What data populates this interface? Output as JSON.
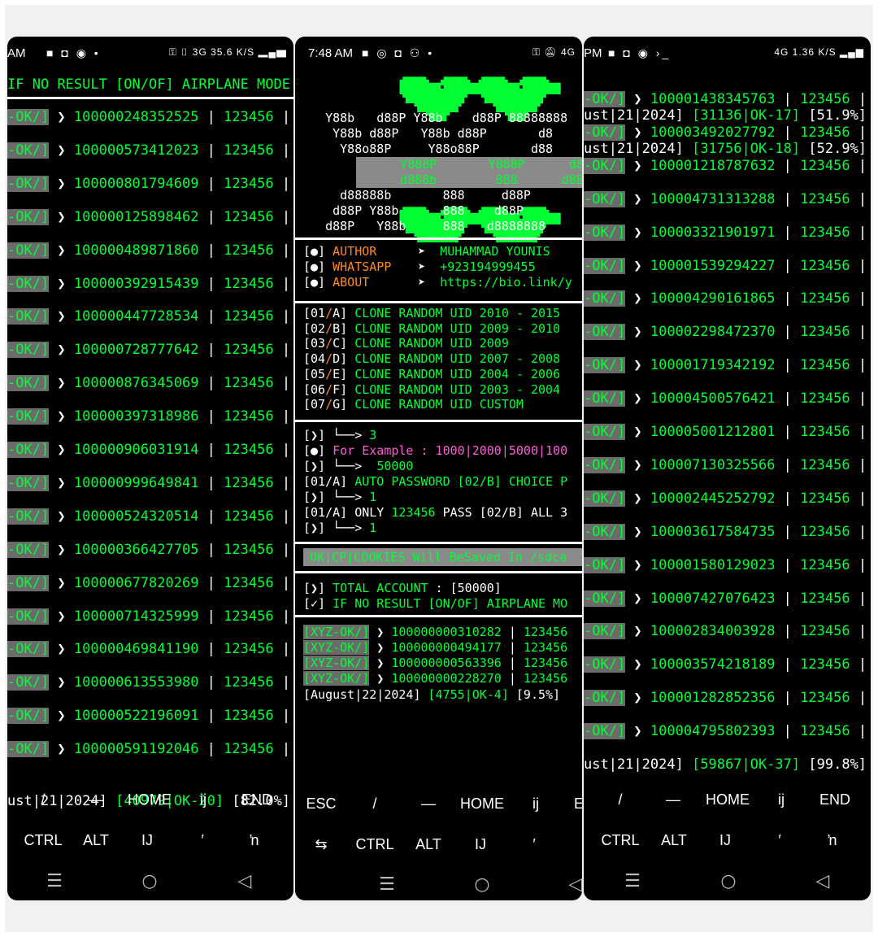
{
  "p1": {
    "status": {
      "time": "AM",
      "right": "3G 35.6 K/S"
    },
    "header": "IF NO RESULT [ON/OF] AIRPLANE MODE",
    "rows": [
      {
        "tag": "-OK/]",
        "uid": "100000248352525",
        "pw": "123456"
      },
      {
        "tag": "-OK/]",
        "uid": "100000573412023",
        "pw": "123456"
      },
      {
        "tag": "-OK/]",
        "uid": "100000801794609",
        "pw": "123456"
      },
      {
        "tag": "-OK/]",
        "uid": "100000125898462",
        "pw": "123456"
      },
      {
        "tag": "-OK/]",
        "uid": "100000489871860",
        "pw": "123456"
      },
      {
        "tag": "-OK/]",
        "uid": "100000392915439",
        "pw": "123456"
      },
      {
        "tag": "-OK/]",
        "uid": "100000447728534",
        "pw": "123456"
      },
      {
        "tag": "-OK/]",
        "uid": "100000728777642",
        "pw": "123456"
      },
      {
        "tag": "-OK/]",
        "uid": "100000876345069",
        "pw": "123456"
      },
      {
        "tag": "-OK/]",
        "uid": "100000397318986",
        "pw": "123456"
      },
      {
        "tag": "-OK/]",
        "uid": "100000906031914",
        "pw": "123456"
      },
      {
        "tag": "-OK/]",
        "uid": "100000999649841",
        "pw": "123456"
      },
      {
        "tag": "-OK/]",
        "uid": "100000524320514",
        "pw": "123456"
      },
      {
        "tag": "-OK/]",
        "uid": "100000366427705",
        "pw": "123456"
      },
      {
        "tag": "-OK/]",
        "uid": "100000677820269",
        "pw": "123456"
      },
      {
        "tag": "-OK/]",
        "uid": "100000714325999",
        "pw": "123456"
      },
      {
        "tag": "-OK/]",
        "uid": "100000469841190",
        "pw": "123456"
      },
      {
        "tag": "-OK/]",
        "uid": "100000613553980",
        "pw": "123456"
      },
      {
        "tag": "-OK/]",
        "uid": "100000522196091",
        "pw": "123456"
      },
      {
        "tag": "-OK/]",
        "uid": "100000591192046",
        "pw": "123456"
      }
    ],
    "footer": {
      "date": "ust|21|2024]",
      "count": "[40979|OK-20]",
      "pct": "[82.0%]"
    },
    "keys1": [
      "/",
      "—",
      "HOME",
      "ij",
      "END"
    ],
    "keys2": [
      "CTRL",
      "ALT",
      "IJ",
      "′",
      "ŉ"
    ]
  },
  "p2": {
    "status": {
      "time": "7:48 AM",
      "right": "4G"
    },
    "ascii": [
      "   Y88b   d88P Y88b    d88P 88888888",
      "    Y88b d88P   Y88b d88P       d8",
      "     Y88o88P     Y88o88P       d88",
      "      Y888P       Y888P      d88P",
      "      d888b        888      d88P",
      "     d88888b       888     d88P",
      "    d88P Y88b      888    d88P",
      "   d88P   Y88b     888   d8888888"
    ],
    "info": [
      {
        "bullet": "[●]",
        "label": "AUTHOR",
        "value": "MUHAMMAD YOUNIS"
      },
      {
        "bullet": "[●]",
        "label": "WHATSAPP",
        "value": "+923194999455"
      },
      {
        "bullet": "[●]",
        "label": "ABOUT",
        "value": "https://bio.link/y"
      }
    ],
    "menu": [
      {
        "num": "01",
        "key": "A",
        "text": "CLONE RANDOM UID 2010 - 2015"
      },
      {
        "num": "02",
        "key": "B",
        "text": "CLONE RANDOM UID 2009 - 2010"
      },
      {
        "num": "03",
        "key": "C",
        "text": "CLONE RANDOM UID 2009"
      },
      {
        "num": "04",
        "key": "D",
        "text": "CLONE RANDOM UID 2007 - 2008"
      },
      {
        "num": "05",
        "key": "E",
        "text": "CLONE RANDOM UID 2004 - 2006"
      },
      {
        "num": "06",
        "key": "F",
        "text": "CLONE RANDOM UID 2003 - 2004"
      },
      {
        "num": "07",
        "key": "G",
        "text": "CLONE RANDOM UID CUSTOM"
      }
    ],
    "input": {
      "ans1": "3",
      "example": "For Example : 1000|2000|5000|100",
      "ans2": "50000",
      "pwq": "AUTO PASSWORD [02/B] CHOICE P",
      "ans3": "1",
      "passq1": "ONLY",
      "passq2": "123456",
      "passq3": "PASS [02/B] ALL 3",
      "ans4": "1"
    },
    "banner": "OK|CP|COOKIES Will BeSaved In /sdca",
    "total": {
      "label": "TOTAL ACCOUNT",
      "value": "[50000]"
    },
    "airplane": "IF NO RESULT [ON/OF] AIRPLANE MO",
    "rows": [
      {
        "tag": "[XYZ-OK/]",
        "uid": "100000000310282",
        "pw": "123456"
      },
      {
        "tag": "[XYZ-OK/]",
        "uid": "100000000494177",
        "pw": "123456"
      },
      {
        "tag": "[XYZ-OK/]",
        "uid": "100000000563396",
        "pw": "123456"
      },
      {
        "tag": "[XYZ-OK/]",
        "uid": "100000000228270",
        "pw": "123456"
      }
    ],
    "footer": {
      "date": "[August|22|2024]",
      "count": "[4755|OK-4]",
      "pct": "[9.5%]"
    },
    "keys1": [
      "ESC",
      "/",
      "—",
      "HOME",
      "ij",
      "E"
    ],
    "keys2": [
      "⇆",
      "CTRL",
      "ALT",
      "IJ",
      "′"
    ]
  },
  "p3": {
    "status": {
      "time": "PM",
      "right": "4G 1.36 K/S"
    },
    "rows": [
      {
        "tag": "-OK/]",
        "uid": "100001438345763",
        "pw": "123456"
      },
      {
        "tag": "ust|21|2024]",
        "uid": "[31136|OK-17]",
        "pw": "[51.9%]",
        "kind": "status"
      },
      {
        "tag": "-OK/]",
        "uid": "100003492027792",
        "pw": "123456"
      },
      {
        "tag": "ust|21|2024]",
        "uid": "[31756|OK-18]",
        "pw": "[52.9%]",
        "kind": "status"
      },
      {
        "tag": "-OK/]",
        "uid": "100001218787632",
        "pw": "123456"
      },
      {
        "tag": "-OK/]",
        "uid": "100004731313288",
        "pw": "123456"
      },
      {
        "tag": "-OK/]",
        "uid": "100003321901971",
        "pw": "123456"
      },
      {
        "tag": "-OK/]",
        "uid": "100001539294227",
        "pw": "123456"
      },
      {
        "tag": "-OK/]",
        "uid": "100004290161865",
        "pw": "123456"
      },
      {
        "tag": "-OK/]",
        "uid": "100002298472370",
        "pw": "123456"
      },
      {
        "tag": "-OK/]",
        "uid": "100001719342192",
        "pw": "123456"
      },
      {
        "tag": "-OK/]",
        "uid": "100004500576421",
        "pw": "123456"
      },
      {
        "tag": "-OK/]",
        "uid": "100005001212801",
        "pw": "123456"
      },
      {
        "tag": "-OK/]",
        "uid": "100007130325566",
        "pw": "123456"
      },
      {
        "tag": "-OK/]",
        "uid": "100002445252792",
        "pw": "123456"
      },
      {
        "tag": "-OK/]",
        "uid": "100003617584735",
        "pw": "123456"
      },
      {
        "tag": "-OK/]",
        "uid": "100001580129023",
        "pw": "123456"
      },
      {
        "tag": "-OK/]",
        "uid": "100007427076423",
        "pw": "123456"
      },
      {
        "tag": "-OK/]",
        "uid": "100002834003928",
        "pw": "123456"
      },
      {
        "tag": "-OK/]",
        "uid": "100003574218189",
        "pw": "123456"
      },
      {
        "tag": "-OK/]",
        "uid": "100001282852356",
        "pw": "123456"
      },
      {
        "tag": "-OK/]",
        "uid": "100004795802393",
        "pw": "123456"
      }
    ],
    "footer": {
      "date": "ust|21|2024]",
      "count": "[59867|OK-37]",
      "pct": "[99.8%]"
    },
    "keys1": [
      "/",
      "—",
      "HOME",
      "ij",
      "END"
    ],
    "keys2": [
      "CTRL",
      "ALT",
      "IJ",
      "′",
      "ŉ"
    ]
  },
  "nav": {
    "menu": "☰",
    "home": "○",
    "back": "◁"
  },
  "colors": {
    "green": "#00ff33",
    "orange": "#ff8a1f",
    "pink": "#ff5bd6",
    "gray": "#6b6b6b"
  }
}
